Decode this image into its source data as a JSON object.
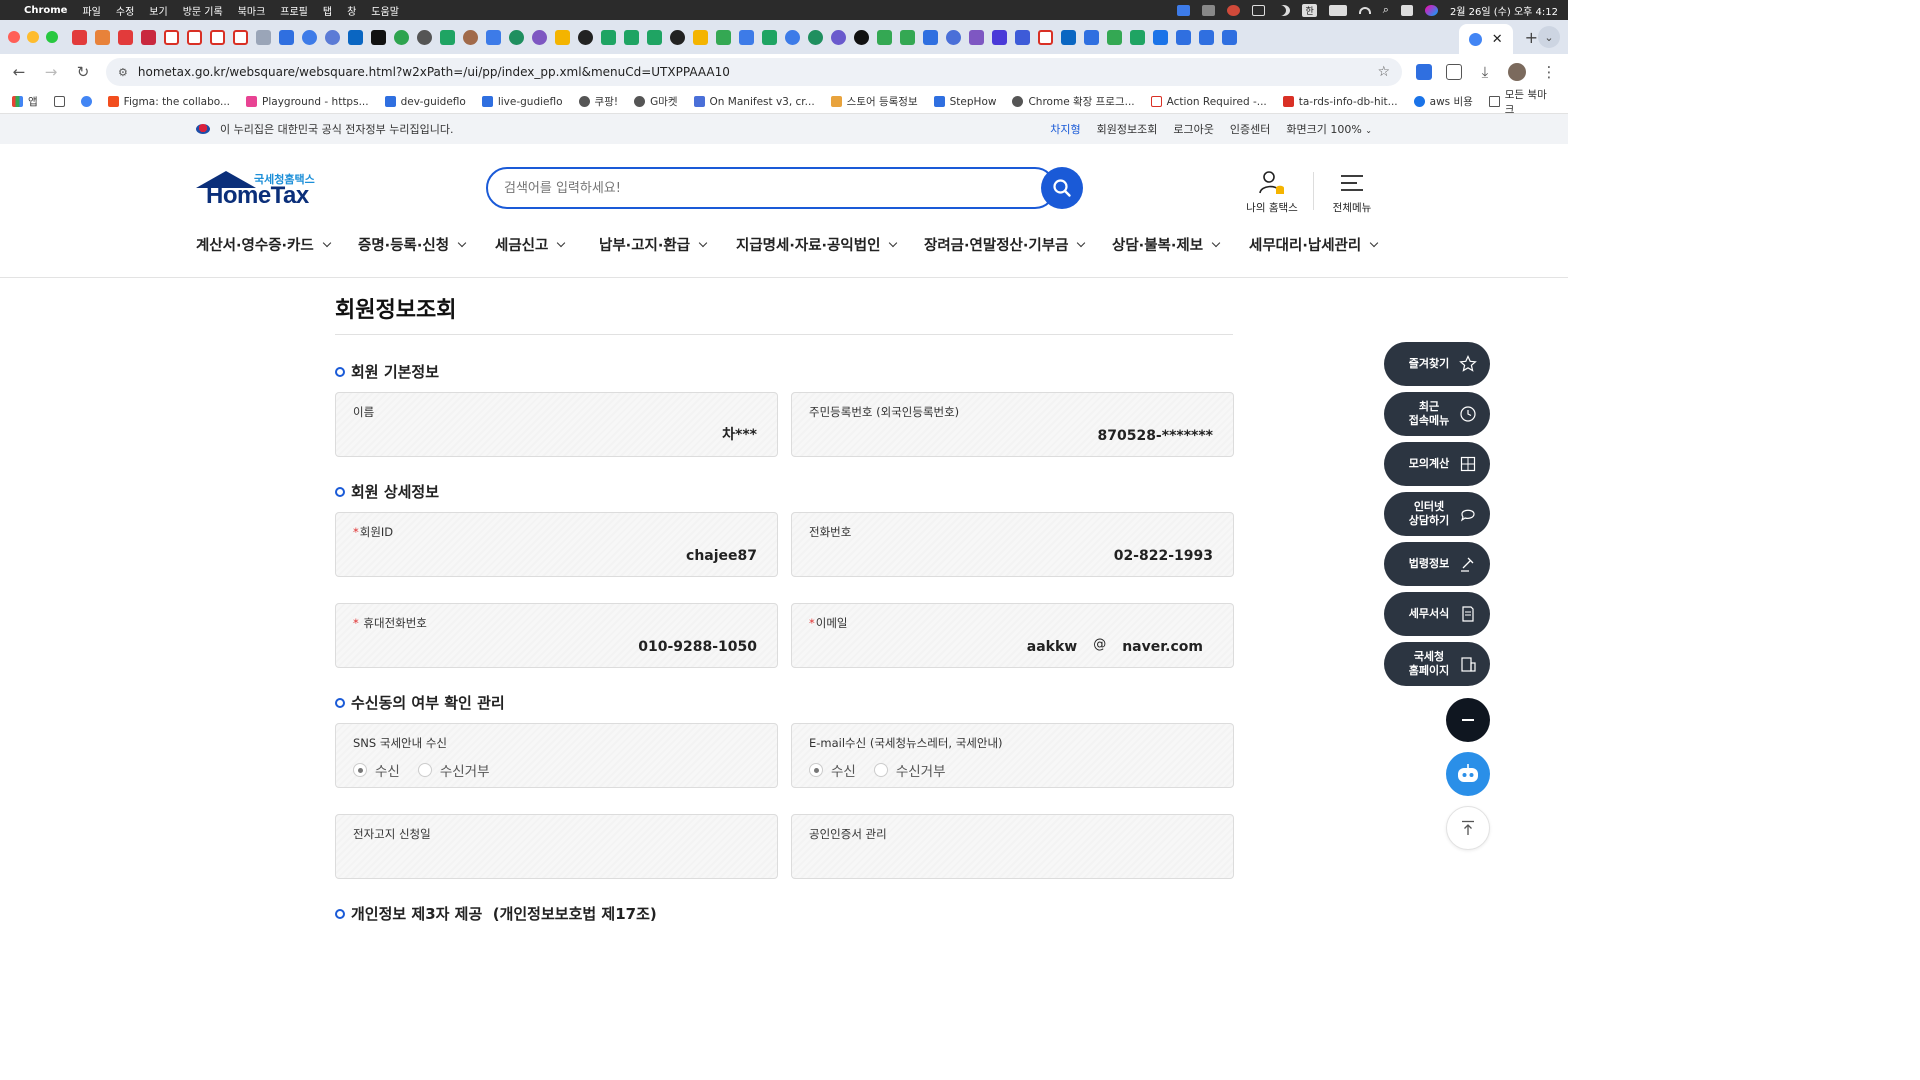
{
  "mac_menubar": {
    "app": "Chrome",
    "items": [
      "파일",
      "수정",
      "보기",
      "방문 기록",
      "북마크",
      "프로필",
      "탭",
      "창",
      "도움말"
    ],
    "input_source": "한",
    "clock": "2월 26일 (수) 오후 4:12"
  },
  "browser": {
    "url": "hometax.go.kr/websquare/websquare.html?w2xPath=/ui/pp/index_pp.xml&menuCd=UTXPPAAA10",
    "bookmarks": [
      {
        "label": "앱",
        "color": "#e94235"
      },
      {
        "label": "",
        "color": "#555555"
      },
      {
        "label": "",
        "color": "#4285f4"
      },
      {
        "label": "Figma: the collabo...",
        "color": "#f24e1e"
      },
      {
        "label": "Playground - https...",
        "color": "#e84393"
      },
      {
        "label": "dev-guideflo",
        "color": "#2f6fe0"
      },
      {
        "label": "live-gudieflo",
        "color": "#2f6fe0"
      },
      {
        "label": "쿠팡!",
        "color": "#555555"
      },
      {
        "label": "G마켓",
        "color": "#555555"
      },
      {
        "label": "On Manifest v3, cr...",
        "color": "#4a6fd8"
      },
      {
        "label": "스토어 등록정보",
        "color": "#e8a33d"
      },
      {
        "label": "StepHow",
        "color": "#2f6fe0"
      },
      {
        "label": "Chrome 확장 프로그...",
        "color": "#555555"
      },
      {
        "label": "Action Required -...",
        "color": "#d93025"
      },
      {
        "label": "ta-rds-info-db-hit...",
        "color": "#d93025"
      },
      {
        "label": "aws 비용",
        "color": "#1a73e8"
      }
    ],
    "all_bookmarks": "모든 북마크"
  },
  "gov_banner": {
    "text": "이 누리집은 대한민국 공식 전자정부 누리집입니다.",
    "user": "차지형",
    "links": [
      "회원정보조회",
      "로그아웃",
      "인증센터"
    ],
    "zoom": "화면크기 100%"
  },
  "header": {
    "logo_sub": "국세청홈택스",
    "logo_main": "HomeTax",
    "search_placeholder": "검색어를 입력하세요!",
    "my_hometax": "나의 홈택스",
    "all_menu": "전체메뉴",
    "gnb": [
      "계산서·영수증·카드",
      "증명·등록·신청",
      "세금신고",
      "납부·고지·환급",
      "지급명세·자료·공익법인",
      "장려금·연말정산·기부금",
      "상담·불복·제보",
      "세무대리·납세관리"
    ]
  },
  "page": {
    "title": "회원정보조회",
    "basic_section": "회원 기본정보",
    "name_label": "이름",
    "name_value": "차***",
    "rrn_label": "주민등록번호 (외국인등록번호)",
    "rrn_value": "870528-*******",
    "detail_section": "회원 상세정보",
    "id_label": "회원ID",
    "id_value": "chajee87",
    "phone_label": "전화번호",
    "phone_value": "02-822-1993",
    "mobile_label": "휴대전화번호",
    "mobile_value": "010-9288-1050",
    "email_label": "이메일",
    "email_user": "aakkw",
    "email_at": "@",
    "email_domain": "naver.com",
    "consent_section": "수신동의 여부 확인 관리",
    "sns_label": "SNS 국세안내 수신",
    "email_recv_label": "E-mail수신 (국세청뉴스레터, 국세안내)",
    "opt_receive": "수신",
    "opt_reject": "수신거부",
    "e_notice_label": "전자고지 신청일",
    "cert_label": "공인인증서 관리",
    "third_party_section": "개인정보 제3자 제공  (개인정보보호법 제17조)"
  },
  "side_menu": [
    "즐겨찾기",
    "최근\n접속메뉴",
    "모의계산",
    "인터넷\n상담하기",
    "법령정보",
    "세무서식",
    "국세청\n홈페이지"
  ]
}
